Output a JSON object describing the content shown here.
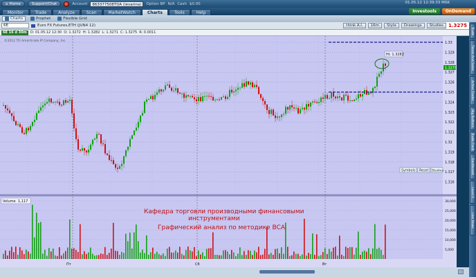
{
  "topbar": {
    "home_label": "Home",
    "support_label": "Support/Chat",
    "account_label": "Account",
    "account_value": "863377508TDA (levarina)",
    "option_bp_label": "Option BP",
    "option_bp_value": "N/A",
    "cash_label": "Cash",
    "cash_value": "$0.00",
    "clock": "01.05.12 12:39:33 MSK"
  },
  "tabs": [
    {
      "label": "Monitor"
    },
    {
      "label": "Trade"
    },
    {
      "label": "Analyze"
    },
    {
      "label": "Scan"
    },
    {
      "label": "MarketWatch"
    },
    {
      "label": "Charts"
    },
    {
      "label": "Tools"
    },
    {
      "label": "Help"
    }
  ],
  "brand": {
    "investools": "Investools",
    "ondemand": "OnDemand"
  },
  "subtabs": [
    {
      "label": "Charts"
    },
    {
      "label": "Prophet"
    },
    {
      "label": "Flexible Grid"
    }
  ],
  "toolbar": {
    "symbol": "6E",
    "description": "Euro FX Futures,ETH (JUN4 12)",
    "thinkai": "think A.I.",
    "interval": "16m",
    "style": "Style",
    "drawings": "Drawings",
    "studies": "Studies",
    "last_price": "1.3275"
  },
  "infobar": {
    "badge": "6E 16 d 30m",
    "date": "D: 01.05.12 12:30",
    "open": "O: 1.3272",
    "high": "H: 1.3282",
    "low": "L: 1.3271",
    "close": "C: 1.3275",
    "range": "R: 0.0011",
    "copyright": "©2012 TD Ameritrade IP Company, Inc."
  },
  "price_pane": {
    "hi_label": "Hi: 1.3282",
    "current_tag": "1.3275",
    "ticks": [
      "1.33",
      "1.329",
      "1.328",
      "1.327",
      "1.326",
      "1.325",
      "1.324",
      "1.323",
      "1.322",
      "1.321",
      "1.32",
      "1.319",
      "1.318",
      "1.317",
      "1.316"
    ]
  },
  "volume_pane": {
    "label": "Volume",
    "value": "1,117",
    "ticks": [
      "30,000",
      "25,000",
      "20,000",
      "15,000",
      "10,000",
      "5,000"
    ]
  },
  "overlay": {
    "line1": "Кафедра торговли производными финансовыми",
    "line2": "инструментами",
    "line3": "Графический анализ по методике ВСА"
  },
  "x_axis": [
    "Пт",
    "Сб",
    "Вт"
  ],
  "buttons": {
    "symbols": "Symbols",
    "reset": "Reset",
    "studies": "Studies"
  },
  "sidebar_tabs": [
    "Live News",
    "Level II",
    "Dashboard",
    "Trade Flash",
    "Big Buttons",
    "Active Trader",
    "Times And Sales",
    "Trade Grid"
  ],
  "colors": {
    "up": "#12a012",
    "down": "#d01010",
    "chart_bg": "#c7c7f2",
    "level_line": "#1a1a8a"
  }
}
